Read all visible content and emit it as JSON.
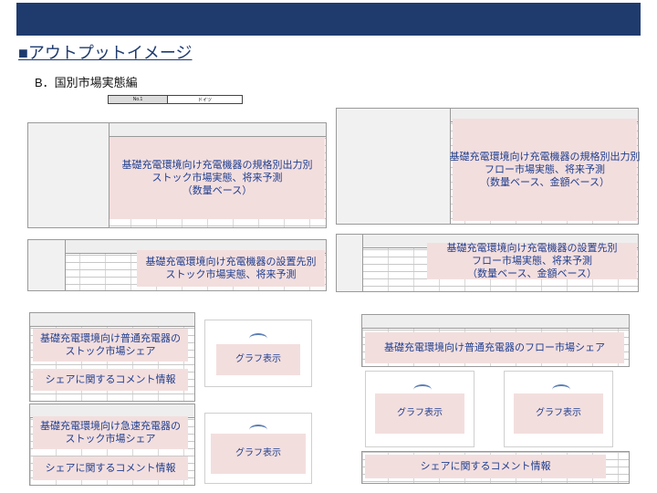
{
  "page": {
    "heading": "■アウトプットイメージ",
    "subheading": "B．国別市場実態編"
  },
  "no_field": {
    "label": "No.1",
    "value": "ドイツ"
  },
  "panels": {
    "p1": {
      "lines": [
        "基礎充電環境向け充電機器の規格別出力別",
        "ストック市場実態、将来予測",
        "（数量ベース）"
      ]
    },
    "p2": {
      "lines": [
        "基礎充電環境向け充電機器の規格別出力別",
        "フロー市場実態、将来予測",
        "（数量ベース、金額ベース）"
      ]
    },
    "p3": {
      "lines": [
        "基礎充電環境向け充電機器の設置先別",
        "ストック市場実態、将来予測"
      ]
    },
    "p4": {
      "lines": [
        "基礎充電環境向け充電機器の設置先別",
        "フロー市場実態、将来予測",
        "（数量ベース、金額ベース）"
      ]
    },
    "p5": {
      "lines": [
        "基礎充電環境向け普通充電器の",
        "ストック市場シェア"
      ],
      "comment": "シェアに関するコメント情報",
      "graph": "グラフ表示"
    },
    "p6": {
      "lines": [
        "基礎充電環境向け普通充電器のフロー市場シェア"
      ],
      "graphs": [
        "グラフ表示",
        "グラフ表示"
      ],
      "comment": "シェアに関するコメント情報"
    },
    "p7": {
      "lines": [
        "基礎充電環境向け急速充電器の",
        "ストック市場シェア"
      ],
      "comment": "シェアに関するコメント情報",
      "graph": "グラフ表示"
    }
  },
  "colors": {
    "band": "#1f3b6e",
    "placeholder_fill": "#f3dede",
    "placeholder_text": "#1f3f8f"
  }
}
